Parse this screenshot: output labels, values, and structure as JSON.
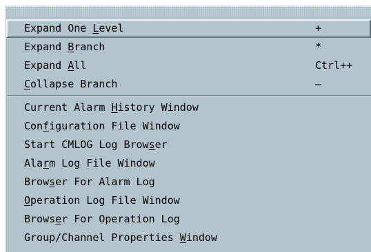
{
  "menu": {
    "group1": [
      {
        "pre": "Expand One ",
        "u": "L",
        "post": "evel",
        "accel": "+"
      },
      {
        "pre": "Expand ",
        "u": "B",
        "post": "ranch",
        "accel": "*"
      },
      {
        "pre": "Expand ",
        "u": "A",
        "post": "ll",
        "accel": "Ctrl++"
      },
      {
        "pre": "",
        "u": "C",
        "post": "ollapse Branch",
        "accel": "–"
      }
    ],
    "group2": [
      {
        "pre": "Current Alarm ",
        "u": "H",
        "post": "istory Window"
      },
      {
        "pre": "Con",
        "u": "f",
        "post": "iguration File Window"
      },
      {
        "pre": "Start CMLOG Log Brow",
        "u": "s",
        "post": "er"
      },
      {
        "pre": "Ala",
        "u": "r",
        "post": "m Log File Window"
      },
      {
        "pre": "Brow",
        "u": "s",
        "post": "er For Alarm Log"
      },
      {
        "pre": "",
        "u": "O",
        "post": "peration Log File Window"
      },
      {
        "pre": "Brows",
        "u": "e",
        "post": "r For Operation Log"
      },
      {
        "pre": "Group/Channel Properties ",
        "u": "W",
        "post": "indow"
      }
    ]
  },
  "colors": {
    "menu_background": "#b4c4cc",
    "highlight_light": "#eef3f5",
    "shadow": "#5e6e76",
    "text": "#000000"
  }
}
